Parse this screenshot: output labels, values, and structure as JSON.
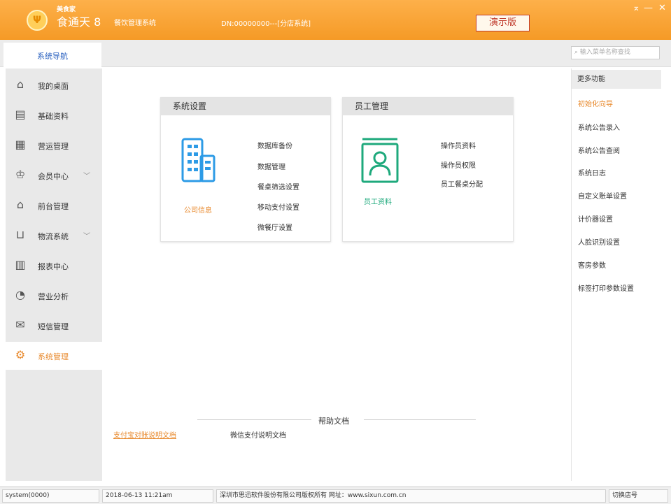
{
  "titlebar": {
    "logo_glyph": "Ψ",
    "brand_small": "美食家",
    "brand_main": "食通天 8",
    "brand_sub": "餐饮管理系统",
    "dn": "DN:00000000---[分店系统]",
    "demo_badge": "演示版",
    "minimize": "—",
    "close": "✕",
    "pin": "⌅"
  },
  "navbar": {
    "tab": "系统导航",
    "search_placeholder": "输入菜单名称查找"
  },
  "sidebar": {
    "items": [
      {
        "label": "我的桌面",
        "icon": "home-icon"
      },
      {
        "label": "基础资料",
        "icon": "document-icon"
      },
      {
        "label": "营运管理",
        "icon": "calendar-icon"
      },
      {
        "label": "会员中心",
        "icon": "crown-icon",
        "expand": true
      },
      {
        "label": "前台管理",
        "icon": "house-icon"
      },
      {
        "label": "物流系统",
        "icon": "cart-icon",
        "expand": true
      },
      {
        "label": "报表中心",
        "icon": "bar-chart-icon"
      },
      {
        "label": "营业分析",
        "icon": "pie-chart-icon"
      },
      {
        "label": "短信管理",
        "icon": "mail-icon"
      },
      {
        "label": "系统管理",
        "icon": "gear-icon",
        "active": true
      }
    ]
  },
  "cards": {
    "system": {
      "title": "系统设置",
      "caption": "公司信息",
      "links": [
        "数据库备份",
        "数据管理",
        "餐桌筛选设置",
        "移动支付设置",
        "微餐厅设置"
      ]
    },
    "staff": {
      "title": "员工管理",
      "caption": "员工资料",
      "links": [
        "操作员资料",
        "操作员权限",
        "员工餐桌分配"
      ]
    }
  },
  "right_panel": {
    "title": "更多功能",
    "items": [
      "初始化向导",
      "系统公告录入",
      "系统公告查阅",
      "系统日志",
      "自定义账单设置",
      "计价器设置",
      "人脸识别设置",
      "客房参数",
      "标签打印参数设置"
    ]
  },
  "help": {
    "title": "帮助文档",
    "link1": "支付宝对账说明文档",
    "link2": "微信支付说明文档"
  },
  "status": {
    "user": "system(0000)",
    "datetime": "2018-06-13 11:21am",
    "copyright": "深圳市思迅软件股份有限公司版权所有 网址：www.sixun.com.cn",
    "switch": "切换店号"
  },
  "colors": {
    "brand_orange": "#f59a26",
    "accent_orange": "#e88a2e",
    "blue": "#2b62c0",
    "teal": "#1ea97c",
    "badge_red": "#c0392b"
  }
}
